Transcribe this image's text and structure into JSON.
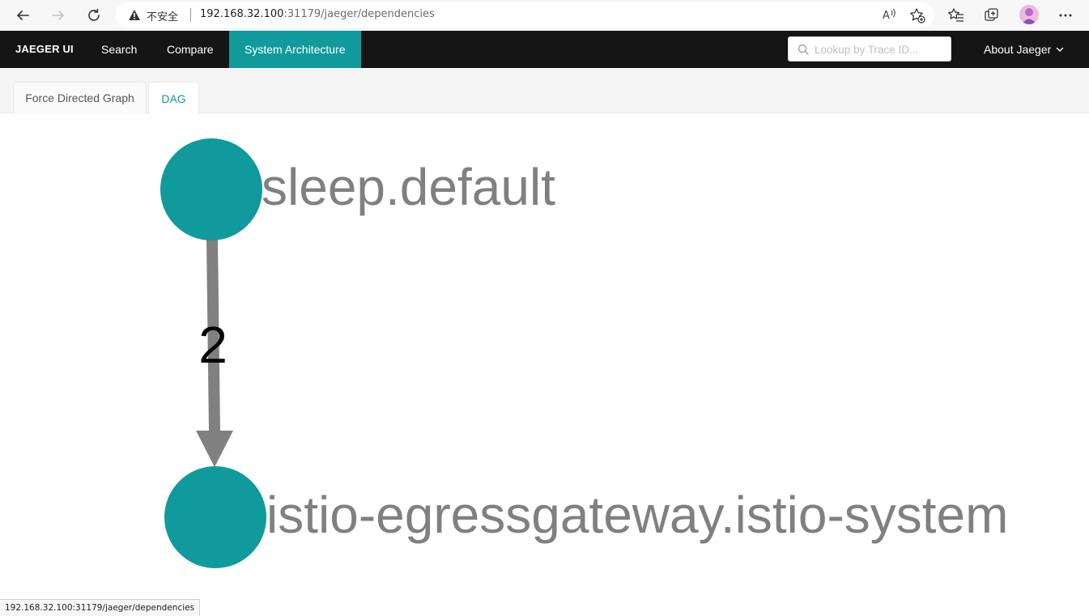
{
  "browser": {
    "security_label": "不安全",
    "url_host": "192.168.32.100",
    "url_rest": ":31179/jaeger/dependencies",
    "status_url": "192.168.32.100:31179/jaeger/dependencies"
  },
  "topnav": {
    "brand": "JAEGER UI",
    "items": [
      {
        "label": "Search"
      },
      {
        "label": "Compare"
      },
      {
        "label": "System Architecture"
      }
    ],
    "lookup_placeholder": "Lookup by Trace ID...",
    "about": "About Jaeger"
  },
  "tabs": [
    {
      "label": "Force Directed Graph"
    },
    {
      "label": "DAG"
    }
  ],
  "dag": {
    "nodes": [
      {
        "label": "sleep.default"
      },
      {
        "label": "istio-egressgateway.istio-system"
      }
    ],
    "edges": [
      {
        "from": "sleep.default",
        "to": "istio-egressgateway.istio-system",
        "label": "2"
      }
    ],
    "node_color": "#119a9c",
    "edge_color": "#808080",
    "label_color": "#808080"
  },
  "colors": {
    "accent": "#119a9c",
    "nav_bg": "#151515"
  }
}
